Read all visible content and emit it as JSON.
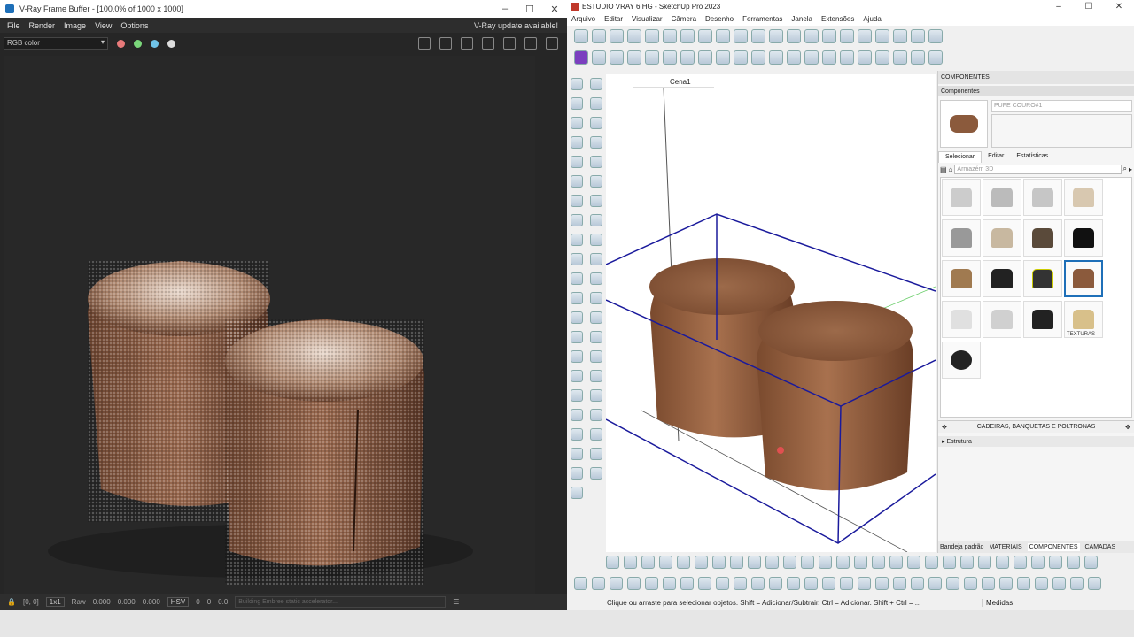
{
  "vfb": {
    "title": "V-Ray Frame Buffer - [100.0% of 1000 x 1000]",
    "menu": [
      "File",
      "Render",
      "Image",
      "View",
      "Options"
    ],
    "update_notice": "V-Ray update available!",
    "channel": "RGB color",
    "status": {
      "coords": "[0, 0]",
      "ratio": "1x1",
      "raw": "Raw",
      "v1": "0.000",
      "v2": "0.000",
      "v3": "0.000",
      "mode": "HSV",
      "h": "0",
      "s": "0",
      "v": "0.0",
      "progress": "Building Embree static accelerator..."
    }
  },
  "sketchup": {
    "title": "ESTUDIO VRAY 6 HG - SketchUp Pro 2023",
    "menu": [
      "Arquivo",
      "Editar",
      "Visualizar",
      "Câmera",
      "Desenho",
      "Ferramentas",
      "Janela",
      "Extensões",
      "Ajuda"
    ],
    "scene_tab": "Cena1",
    "tray": {
      "header": "COMPONENTES",
      "section": "Componentes",
      "component_name": "PUFE COURO#1",
      "tabs": [
        "Selecionar",
        "Editar",
        "Estatísticas"
      ],
      "search_placeholder": "Armazém 3D",
      "collection": "CADEIRAS, BANQUETAS E POLTRONAS",
      "structure": "Estrutura",
      "texturas_label": "TEXTURAS",
      "bottom_tabs": [
        "Bandeja padrão",
        "MATERIAIS",
        "COMPONENTES",
        "CAMADAS"
      ]
    },
    "status_message": "Clique ou arraste para selecionar objetos. Shift = Adicionar/Subtrair. Ctrl = Adicionar. Shift + Ctrl = ...",
    "measures_label": "Medidas"
  },
  "colors": {
    "vfb_bg": "#282828",
    "leather": "#8b5a3c",
    "selection": "#1a1a9c",
    "su_accent": "#1e6fb8"
  }
}
